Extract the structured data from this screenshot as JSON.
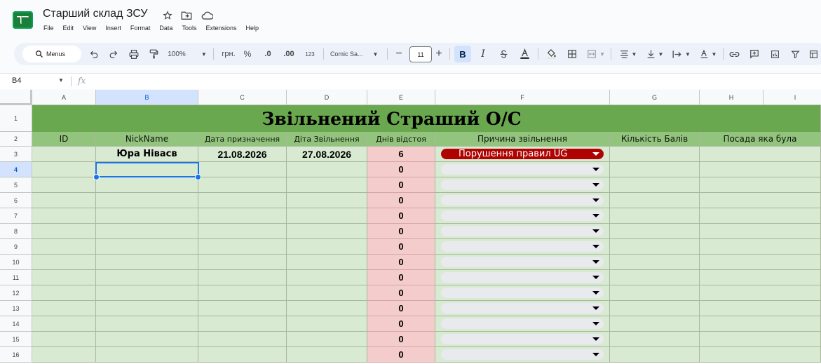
{
  "app": {
    "doc_title": "Старший склад ЗСУ",
    "menu": [
      "File",
      "Edit",
      "View",
      "Insert",
      "Format",
      "Data",
      "Tools",
      "Extensions",
      "Help"
    ]
  },
  "toolbar": {
    "search_label": "Menus",
    "zoom": "100%",
    "currency": "грн.",
    "percent": "%",
    "dec_decrease": ".0",
    "dec_increase": ".00",
    "number_format": "123",
    "font": "Comic Sa...",
    "font_size": "11",
    "bold": "B",
    "italic": "I"
  },
  "formula_bar": {
    "name_box": "B4",
    "fx": "fx"
  },
  "columns": [
    "A",
    "B",
    "C",
    "D",
    "E",
    "F",
    "G",
    "H",
    "I"
  ],
  "rows": [
    "1",
    "2",
    "3",
    "4",
    "5",
    "6",
    "7",
    "8",
    "9",
    "10",
    "11",
    "12",
    "13",
    "14",
    "15",
    "16"
  ],
  "sheet": {
    "title": "Звільнений Страший О/С",
    "headers": [
      "ID",
      "NickName",
      "Дата призначення",
      "Діта Звільнення",
      "Днів відстоя",
      "Причина звільнення",
      "Кількість Балів",
      "Посада яка була",
      ""
    ],
    "row3": {
      "nick": "Юра Нівасв",
      "assigned": "21.08.2026",
      "dismissed": "27.08.2026",
      "days": "6",
      "reason": "Порушення правил UG"
    },
    "days_rest": [
      "0",
      "0",
      "0",
      "0",
      "0",
      "0",
      "0",
      "0",
      "0",
      "0",
      "0",
      "0",
      "0"
    ]
  },
  "colors": {
    "title_bg": "#6aa84f",
    "header_bg": "#93c47d",
    "body_bg": "#d9ead3",
    "days_bg": "#f4cccc",
    "reason_chip": "#b10202",
    "selection": "#1a73e8"
  }
}
